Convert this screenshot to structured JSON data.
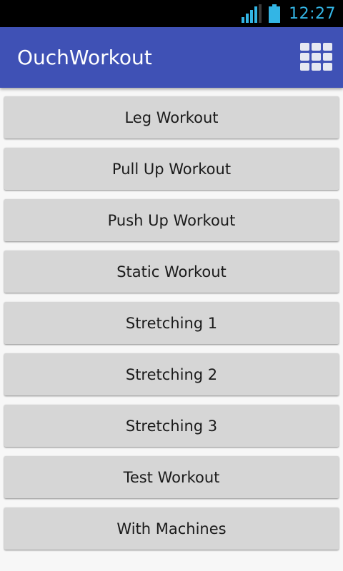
{
  "status_bar": {
    "time": "12:27",
    "signal_icon": "signal-icon",
    "battery_icon": "battery-icon",
    "accent_color": "#33b5e5"
  },
  "app_bar": {
    "title": "OuchWorkout",
    "menu_icon": "grid-icon",
    "color": "#3f51b5"
  },
  "workouts": [
    {
      "label": "Leg Workout"
    },
    {
      "label": "Pull Up Workout"
    },
    {
      "label": "Push Up Workout"
    },
    {
      "label": "Static Workout"
    },
    {
      "label": "Stretching 1"
    },
    {
      "label": "Stretching 2"
    },
    {
      "label": "Stretching 3"
    },
    {
      "label": "Test Workout"
    },
    {
      "label": "With Machines"
    }
  ]
}
